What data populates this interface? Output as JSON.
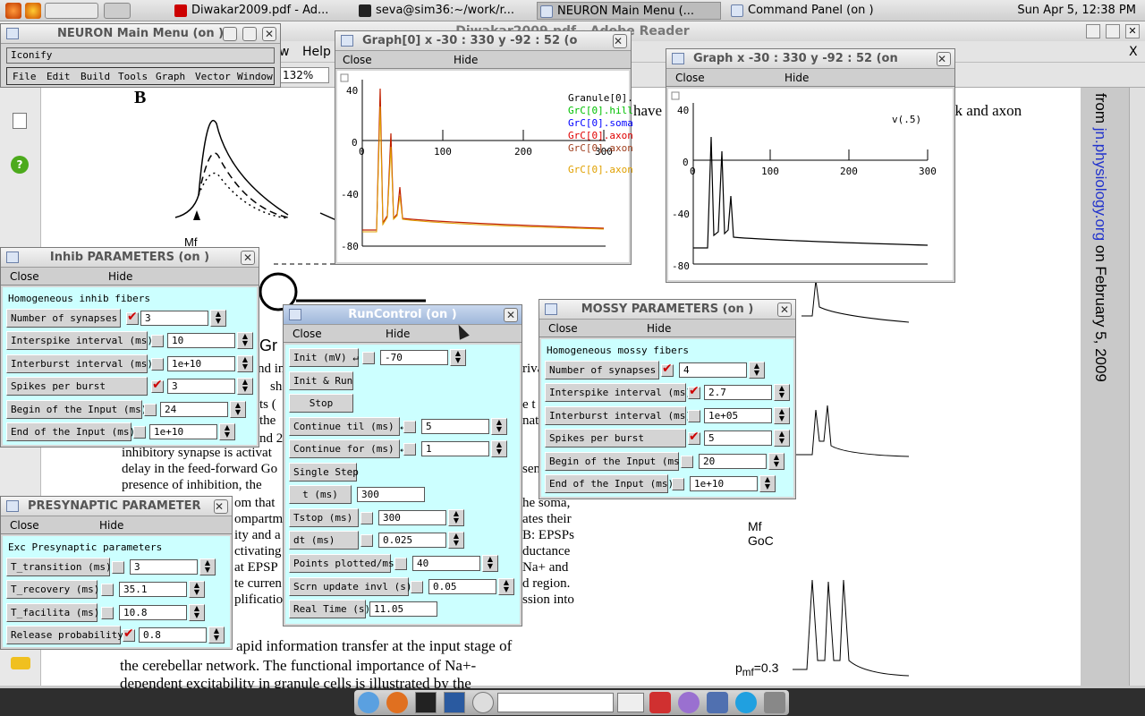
{
  "taskbar": {
    "tasks": [
      {
        "label": "Diwakar2009.pdf - Ad..."
      },
      {
        "label": "seva@sim36:~/work/r..."
      },
      {
        "label": "NEURON Main Menu (..."
      },
      {
        "label": "Command Panel (on )"
      }
    ],
    "clock": "Sun Apr  5, 12:38 PM"
  },
  "reader": {
    "title": "Diwakar2009.pdf - Adobe Reader",
    "menu_help": "Help",
    "menu_w": "w",
    "zoom": "132%",
    "close_x": "X",
    "fig_letter": "B",
    "fig_mf": "Mf",
    "fig_gr": "Gr",
    "fig_mf2": "Mf",
    "fig_goc": "GoC",
    "fig_pmf": "p",
    "fig_pmf_sub": "mf",
    "fig_pmf_val": "=0.3",
    "side_text_pre": "from ",
    "side_link": "jn.physiology.org",
    "side_text_post": " on February 5, 2009",
    "lines": [
      "have",
      "ck and axon",
      "nd in",
      "rivat",
      "sh",
      "ts (",
      "e t",
      "the",
      "nat",
      "nd 2",
      "sen",
      "inhibitory synapse is activat",
      "delay in the feed-forward Go",
      "presence of inhibition, the",
      "om that",
      "he soma,",
      "ompartm",
      "ates their",
      "ity and a",
      "B: EPSPs",
      "ctivating",
      "ductance",
      "at EPSP",
      "Na+ and",
      "te curren",
      "d region.",
      "plificatio",
      "ssion into",
      "apid information transfer at the input stage of",
      "the cerebellar network. The functional importance of Na+-",
      "dependent excitability in granule cells is illustrated by the"
    ]
  },
  "main_menu": {
    "title": "NEURON Main Menu (on )",
    "iconify": "Iconify",
    "items": [
      "File",
      "Edit",
      "Build",
      "Tools",
      "Graph",
      "Vector",
      "Window"
    ]
  },
  "graph0": {
    "title": "Graph[0]  x -30 : 330  y -92 : 52 (o",
    "close": "Close",
    "hide": "Hide",
    "legend": [
      {
        "label": "Granule[0].",
        "color": "#000000"
      },
      {
        "label": "GrC[0].hill",
        "color": "#00c000"
      },
      {
        "label": "GrC[0].soma",
        "color": "#0000ff"
      },
      {
        "label": "GrC[0].axon",
        "color": "#e00000"
      },
      {
        "label": "GrC[0].axon",
        "color": "#a04020"
      },
      {
        "label": "GrC[0].axon",
        "color": "#e0a000"
      }
    ],
    "xticks": [
      "0",
      "100",
      "200",
      "300"
    ],
    "yticks": [
      "40",
      "0",
      "-40",
      "-80"
    ]
  },
  "graph1": {
    "title": "Graph  x -30 : 330  y -92 : 52 (on",
    "close": "Close",
    "hide": "Hide",
    "legend": "v(.5)",
    "xticks": [
      "0",
      "100",
      "200",
      "300"
    ],
    "yticks": [
      "40",
      "0",
      "-40",
      "-80"
    ]
  },
  "inhib": {
    "title": "Inhib PARAMETERS (on )",
    "close": "Close",
    "hide": "Hide",
    "header": "Homogeneous inhib fibers",
    "rows": [
      {
        "label": "Number of synapses",
        "value": "3",
        "checked": true
      },
      {
        "label": "Interspike interval (ms)",
        "value": "10",
        "checked": false
      },
      {
        "label": "Interburst interval (ms)",
        "value": "1e+10",
        "checked": false
      },
      {
        "label": "Spikes per burst",
        "value": "3",
        "checked": true
      },
      {
        "label": "Begin of the Input (ms)",
        "value": "24",
        "checked": false
      },
      {
        "label": "End of the Input (ms)",
        "value": "1e+10",
        "checked": false
      }
    ]
  },
  "presyn": {
    "title": "PRESYNAPTIC PARAMETER",
    "close": "Close",
    "hide": "Hide",
    "header": "Exc Presynaptic parameters",
    "rows": [
      {
        "label": "T_transition (ms)",
        "value": "3",
        "checked": false
      },
      {
        "label": "T_recovery (ms)",
        "value": "35.1",
        "checked": false
      },
      {
        "label": "T_facilita (ms)",
        "value": "10.8",
        "checked": false
      },
      {
        "label": "Release probability",
        "value": "0.8",
        "checked": true
      }
    ]
  },
  "runcontrol": {
    "title": "RunControl (on )",
    "close": "Close",
    "hide": "Hide",
    "init_label": "Init (mV) ↵",
    "init_value": "-70",
    "init_run": "Init & Run",
    "stop": "Stop",
    "cont_til_label": "Continue til (ms) ↵",
    "cont_til_value": "5",
    "cont_for_label": "Continue for (ms) ↵",
    "cont_for_value": "1",
    "single_step": "Single Step",
    "t_label": "t (ms)",
    "t_value": "300",
    "tstop_label": "Tstop (ms)",
    "tstop_value": "300",
    "dt_label": "dt (ms)",
    "dt_value": "0.025",
    "pts_label": "Points plotted/ms",
    "pts_value": "40",
    "scrn_label": "Scrn update invl (s)",
    "scrn_value": "0.05",
    "rt_label": "Real Time (s)",
    "rt_value": "11.05"
  },
  "mossy": {
    "title": "MOSSY PARAMETERS (on )",
    "close": "Close",
    "hide": "Hide",
    "header": "Homogeneous mossy fibers",
    "rows": [
      {
        "label": "Number of synapses",
        "value": "4",
        "checked": true
      },
      {
        "label": "Interspike interval (ms)",
        "value": "2.7",
        "checked": true
      },
      {
        "label": "Interburst interval (ms)",
        "value": "1e+05",
        "checked": false
      },
      {
        "label": "Spikes per burst",
        "value": "5",
        "checked": true
      },
      {
        "label": "Begin of the Input (ms)",
        "value": "20",
        "checked": false
      },
      {
        "label": "End of the Input (ms)",
        "value": "1e+10",
        "checked": false
      }
    ]
  }
}
